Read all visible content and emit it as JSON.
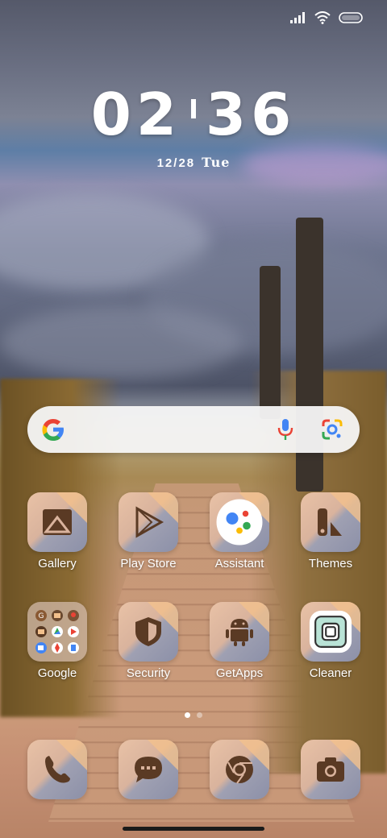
{
  "status": {
    "signal_icon": "signal-icon",
    "wifi_icon": "wifi-icon",
    "battery_icon": "battery-icon"
  },
  "clock": {
    "hour": "02",
    "minute": "36"
  },
  "date": {
    "date": "12/28",
    "day": "Tue"
  },
  "search": {
    "google_icon": "google-g-icon",
    "mic_icon": "mic-icon",
    "lens_icon": "lens-icon"
  },
  "apps": [
    {
      "label": "Gallery",
      "icon": "gallery-icon"
    },
    {
      "label": "Play Store",
      "icon": "play-store-icon"
    },
    {
      "label": "Assistant",
      "icon": "assistant-icon"
    },
    {
      "label": "Themes",
      "icon": "themes-icon"
    },
    {
      "label": "Google",
      "icon": "folder-icon"
    },
    {
      "label": "Security",
      "icon": "shield-icon"
    },
    {
      "label": "GetApps",
      "icon": "android-icon"
    },
    {
      "label": "Cleaner",
      "icon": "cleaner-icon"
    }
  ],
  "dock": [
    {
      "icon": "phone-icon"
    },
    {
      "icon": "messages-icon"
    },
    {
      "icon": "chrome-icon"
    },
    {
      "icon": "camera-icon"
    }
  ],
  "pager": {
    "pages": 2,
    "current": 1
  },
  "colors": {
    "icon_glyph": "#5a3a24",
    "accent_corner": "#f2c08c"
  }
}
